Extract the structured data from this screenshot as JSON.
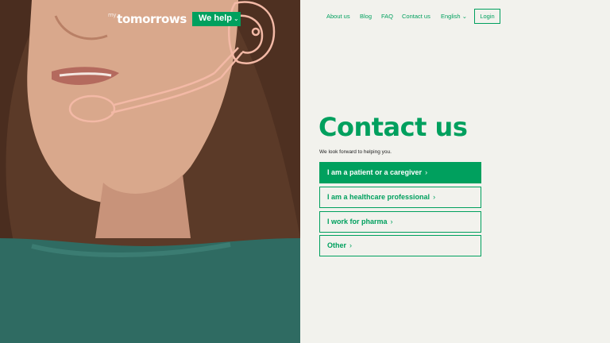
{
  "brand": {
    "logo_prefix": "my",
    "logo_text": "tomorrows"
  },
  "header": {
    "we_help_label": "We help",
    "nav": [
      "About us",
      "Blog",
      "FAQ",
      "Contact us",
      "English"
    ],
    "login_label": "Login"
  },
  "main": {
    "title": "Contact us",
    "subtitle": "We look forward to helping you.",
    "options": [
      "I am a patient or a caregiver",
      "I am a healthcare professional",
      "I work for pharma",
      "Other"
    ]
  },
  "colors": {
    "accent": "#00a05e",
    "background": "#f2f2ed",
    "headset_outline": "#f3b9a6"
  },
  "icons": [
    "chevron-down-icon",
    "chevron-right-icon",
    "headset-illustration"
  ]
}
